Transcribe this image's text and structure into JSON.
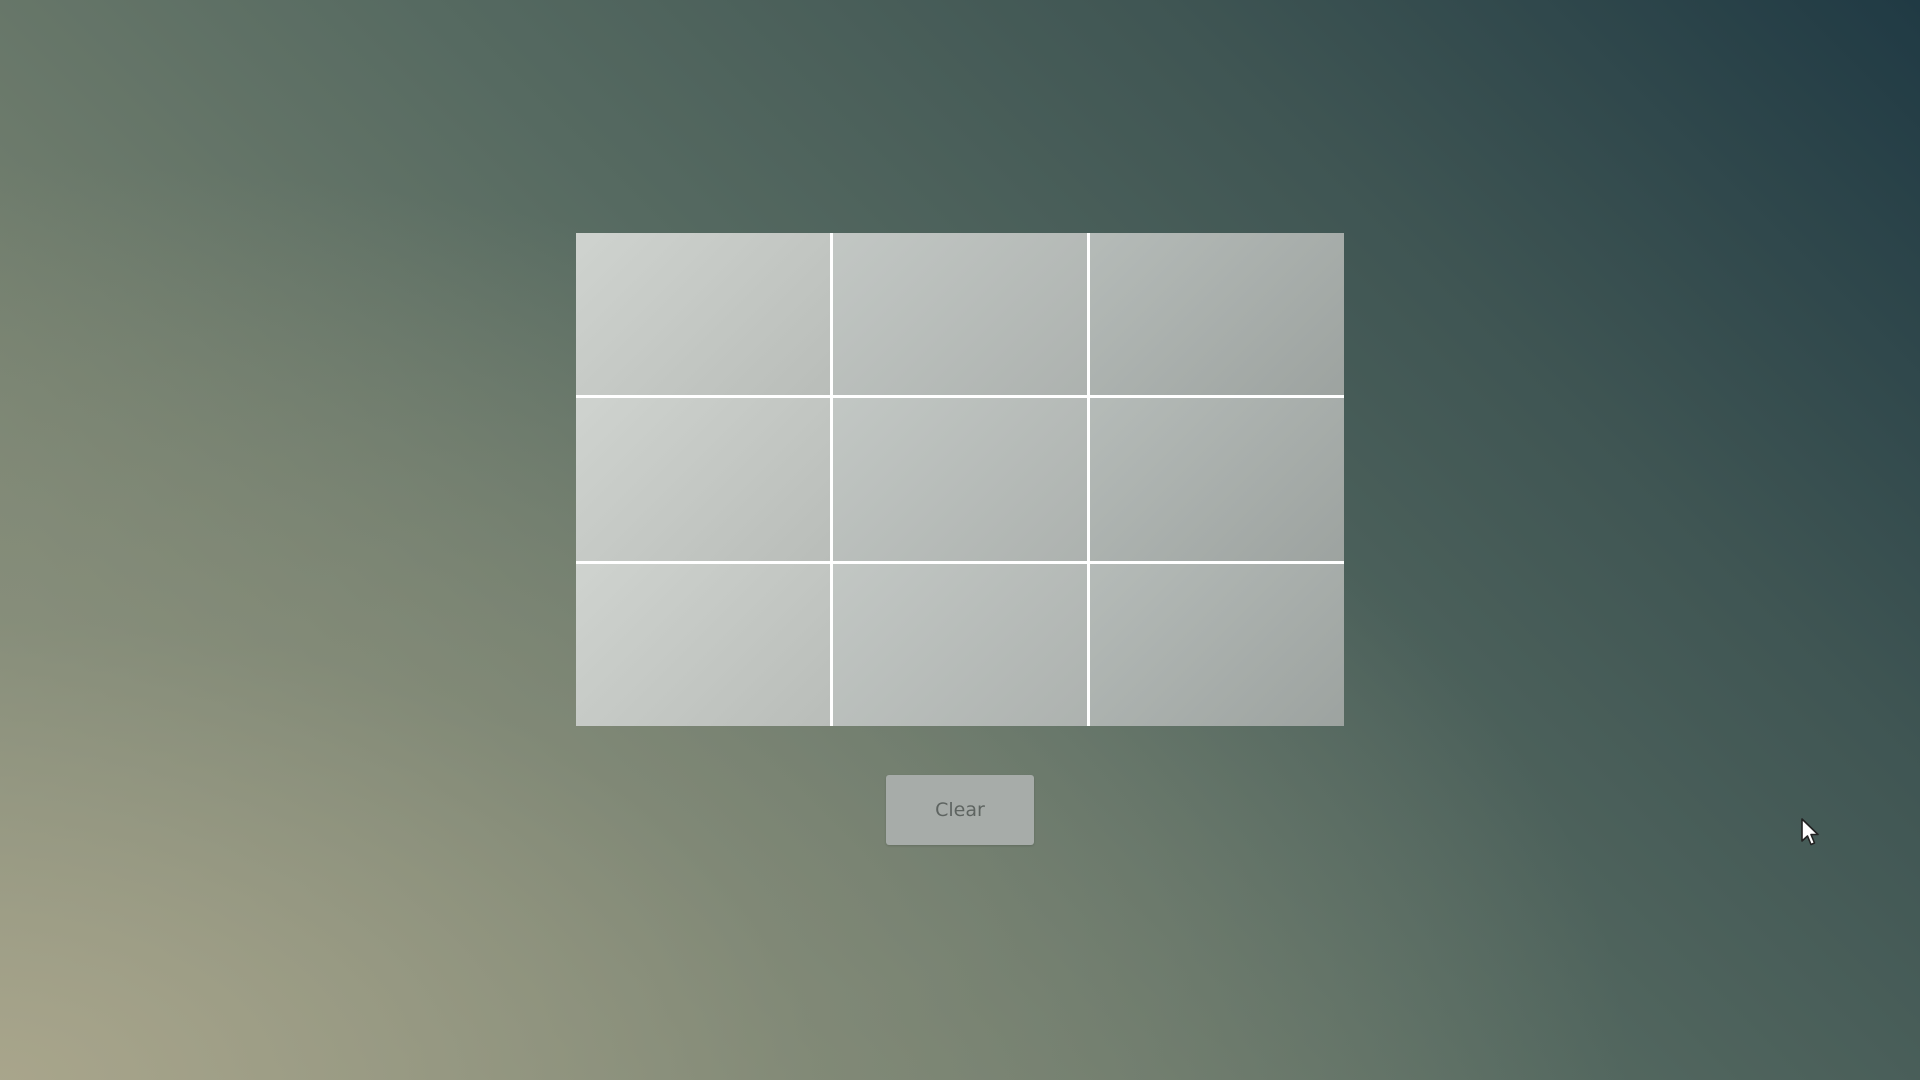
{
  "grid": {
    "rows": 3,
    "columns": 3,
    "cells": [
      "",
      "",
      "",
      "",
      "",
      "",
      "",
      "",
      ""
    ]
  },
  "controls": {
    "clear_label": "Clear"
  },
  "colors": {
    "grid_lines": "#ffffff",
    "cell_fill": "#c2c7c4",
    "button_bg": "#a7aca9",
    "button_text": "#5e6461"
  },
  "icons": {
    "cursor": "mouse-pointer-icon"
  }
}
